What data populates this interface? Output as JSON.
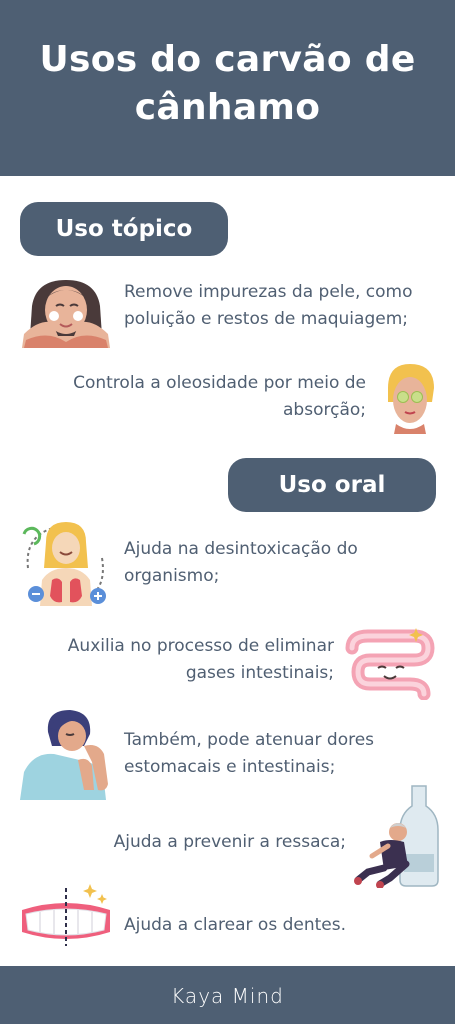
{
  "title_line1": "Usos do carvão de",
  "title_line2": "cânhamo",
  "sections": {
    "topical": {
      "label": "Uso tópico",
      "items": [
        {
          "line1": "Remove impurezas da pele, como",
          "line2": "poluição e restos de maquiagem;"
        },
        {
          "line1": "Controla a oleosidade por meio de",
          "line2": "absorção;"
        }
      ]
    },
    "oral": {
      "label": "Uso oral",
      "items": [
        {
          "line1": "Ajuda na desintoxicação do",
          "line2": "organismo;"
        },
        {
          "line1": "Auxilia no processo de eliminar",
          "line2": "gases intestinais;"
        },
        {
          "line1": "Também, pode atenuar dores",
          "line2": "estomacais e intestinais;"
        },
        {
          "line1": "Ajuda a prevenir a ressaca;"
        },
        {
          "line1": "Ajuda a clarear os dentes."
        }
      ]
    }
  },
  "footer": {
    "brand": "Kaya Mind"
  },
  "colors": {
    "header_bg": "#4e5f73",
    "text": "#505f72",
    "skin": "#e8b49a",
    "accent_pink": "#f06d8c",
    "accent_yellow": "#f2c14e"
  },
  "icons": [
    "face-cleansing-icon",
    "face-mask-icon",
    "detox-body-icon",
    "intestine-icon",
    "stomach-pain-icon",
    "hangover-icon",
    "teeth-whitening-icon"
  ]
}
